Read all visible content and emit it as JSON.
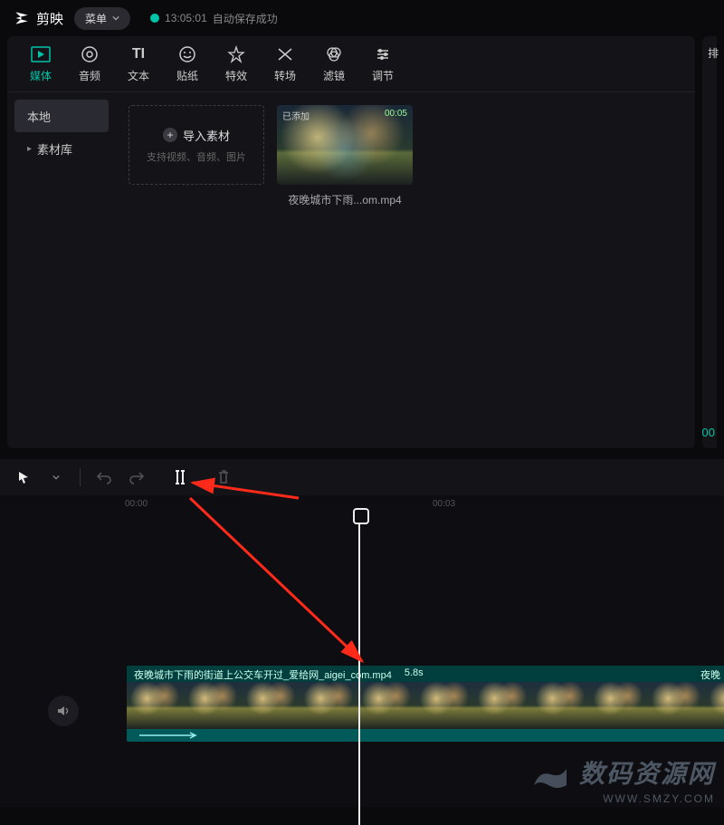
{
  "app": {
    "name": "剪映"
  },
  "topbar": {
    "menu_label": "菜单",
    "save_time": "13:05:01",
    "save_text": "自动保存成功"
  },
  "tabs": [
    {
      "id": "media",
      "label": "媒体",
      "active": true
    },
    {
      "id": "audio",
      "label": "音频"
    },
    {
      "id": "text",
      "label": "文本"
    },
    {
      "id": "sticker",
      "label": "贴纸"
    },
    {
      "id": "effect",
      "label": "特效"
    },
    {
      "id": "transition",
      "label": "转场"
    },
    {
      "id": "filter",
      "label": "滤镜"
    },
    {
      "id": "adjust",
      "label": "调节"
    }
  ],
  "sidebar": {
    "local": "本地",
    "library": "素材库"
  },
  "import": {
    "label": "导入素材",
    "sub": "支持视频、音频、图片"
  },
  "clip": {
    "badge_left": "已添加",
    "badge_right": "00:05",
    "label": "夜晚城市下雨...om.mp4"
  },
  "right_panel": {
    "top_char": "排",
    "time": "00"
  },
  "ruler": {
    "marks": [
      "00:00",
      "00:03"
    ]
  },
  "timeline_clip": {
    "filename": "夜晚城市下雨的街道上公交车开过_爱给网_aigei_com.mp4",
    "duration": "5.8s",
    "second_label": "夜晚"
  },
  "watermark": {
    "line1": "数码资源网",
    "line2": "WWW.SMZY.COM"
  }
}
